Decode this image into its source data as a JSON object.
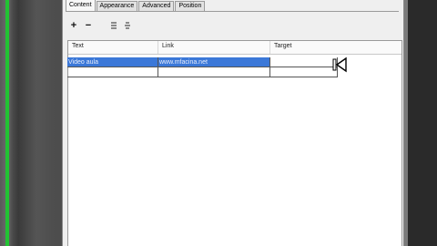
{
  "tabs": [
    {
      "label": "Content",
      "active": true
    },
    {
      "label": "Appearance",
      "active": false
    },
    {
      "label": "Advanced",
      "active": false
    },
    {
      "label": "Position",
      "active": false
    }
  ],
  "toolbar": {
    "add_label": "+",
    "remove_label": "−",
    "icons": [
      "align-icon",
      "distribute-icon"
    ]
  },
  "grid": {
    "columns": [
      "Text",
      "Link",
      "Target"
    ],
    "rows": [
      [
        "Video aula",
        "www.mfacina.net",
        ""
      ],
      [
        "",
        "",
        ""
      ]
    ]
  },
  "colors": {
    "selection": "#3b78d8",
    "accent_green": "#22c433"
  }
}
